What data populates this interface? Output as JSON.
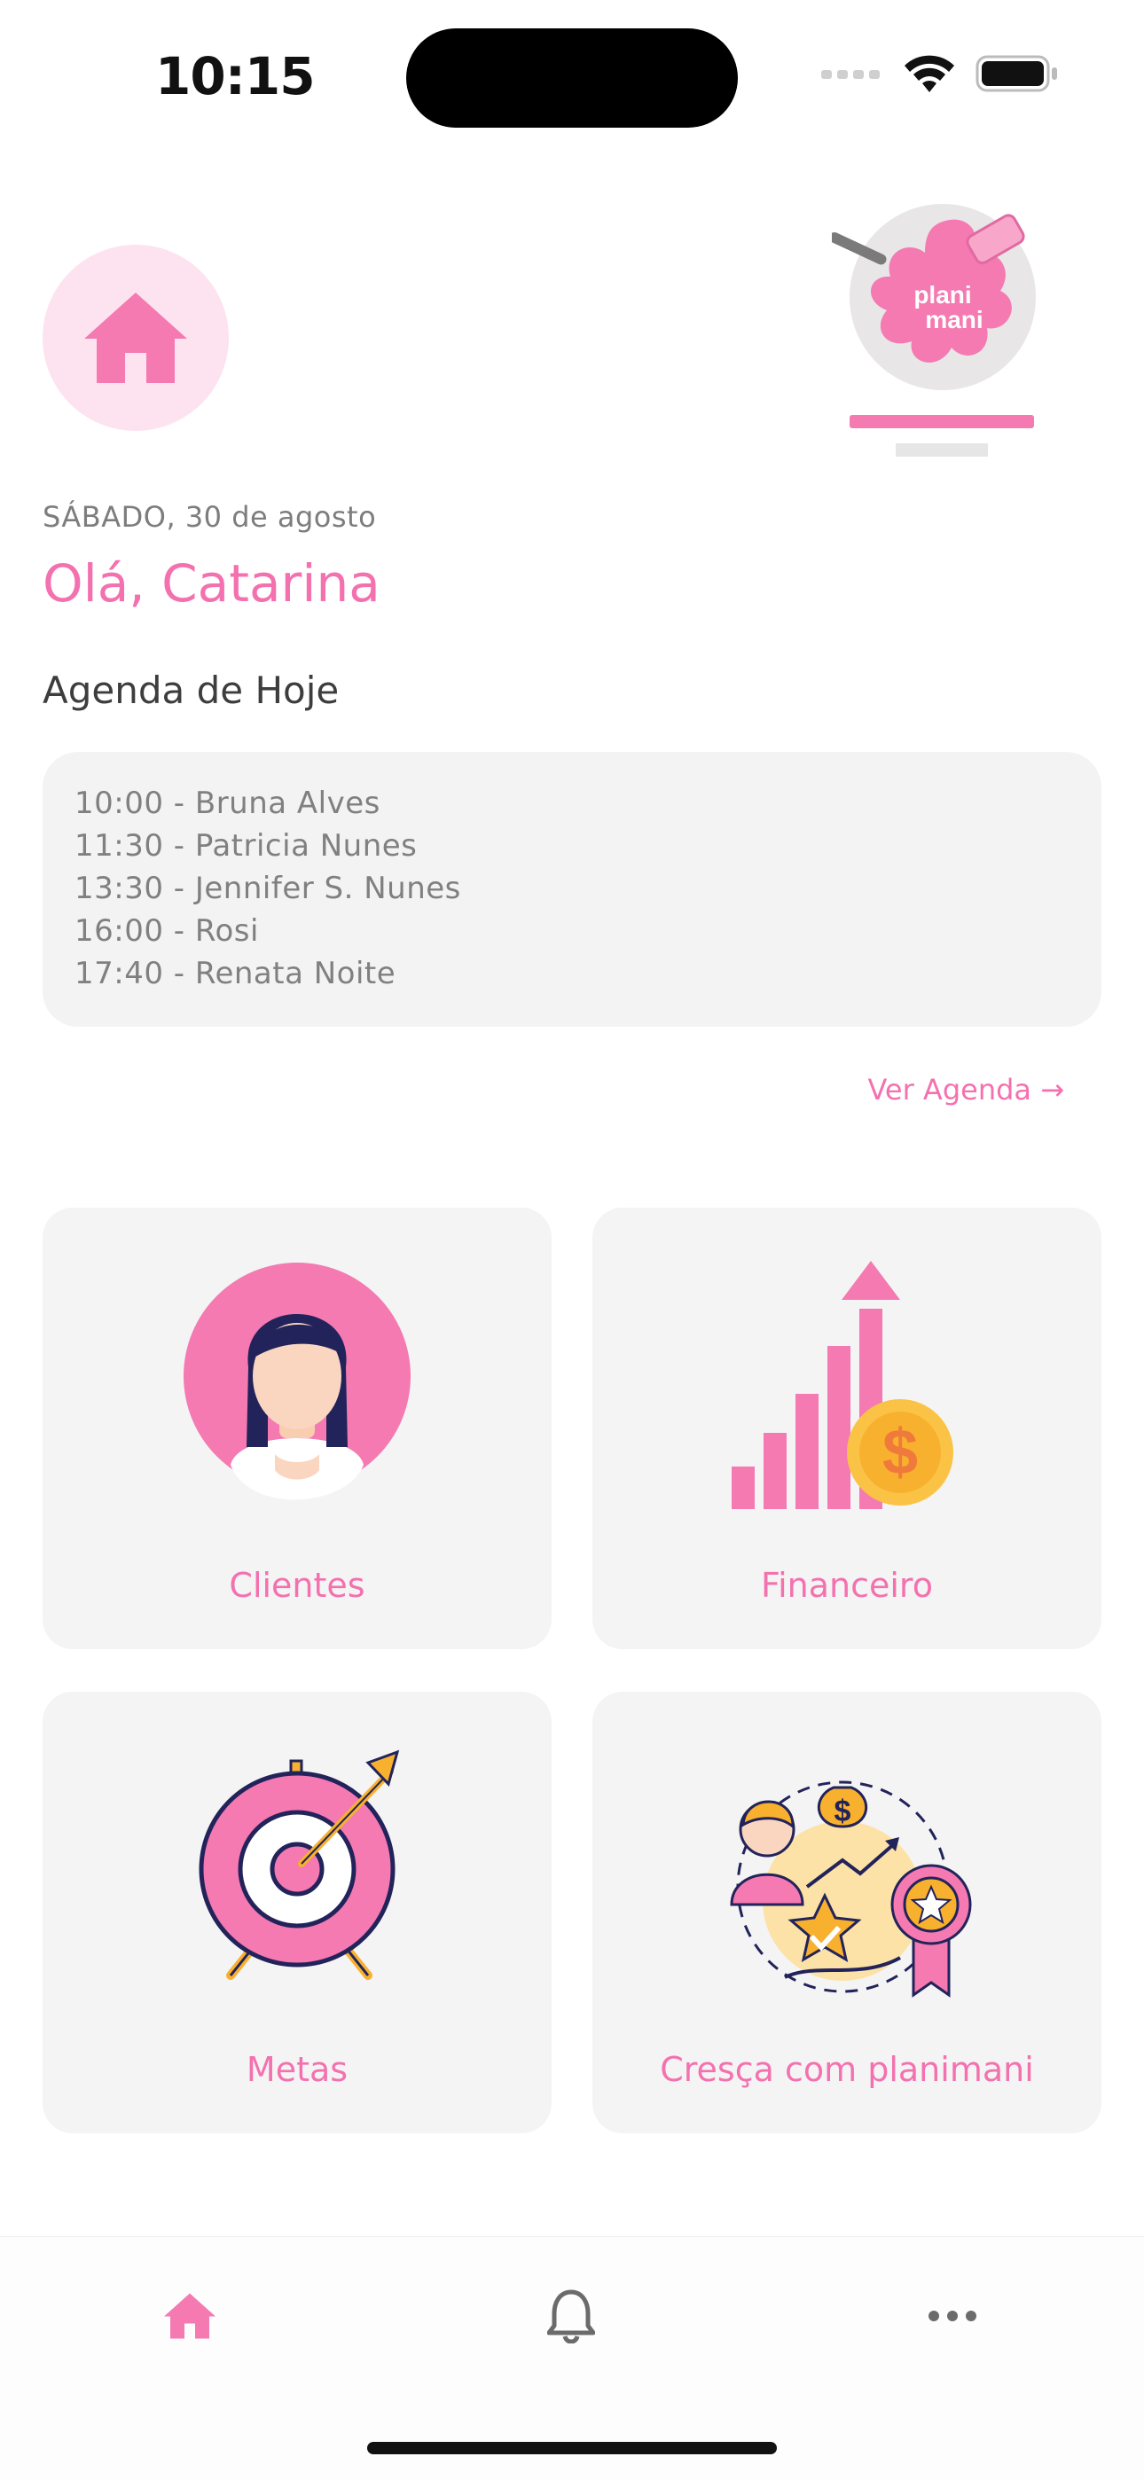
{
  "status_bar": {
    "time": "10:15"
  },
  "header": {
    "home_icon": "home-icon",
    "logo_text_line1": "plani",
    "logo_text_line2": "mani"
  },
  "greeting": {
    "date": "SÁBADO, 30 de agosto",
    "hello": "Olá, Catarina"
  },
  "agenda": {
    "title": "Agenda de Hoje",
    "items": [
      "10:00 - Bruna Alves",
      "11:30 - Patricia Nunes",
      "13:30 - Jennifer S. Nunes",
      "16:00 - Rosi",
      "17:40 - Renata Noite"
    ],
    "link": "Ver Agenda →"
  },
  "tiles": [
    {
      "label": "Clientes",
      "icon": "client-avatar-icon"
    },
    {
      "label": "Financeiro",
      "icon": "growth-chart-icon"
    },
    {
      "label": "Metas",
      "icon": "target-icon"
    },
    {
      "label": "Cresça com planimani",
      "icon": "growth-illustration-icon"
    }
  ],
  "tabbar": {
    "items": [
      "home-icon",
      "bell-icon",
      "more-icon"
    ],
    "active": "home-icon"
  },
  "colors": {
    "accent": "#f471af",
    "accent_light": "#fde3ef",
    "card": "#f4f4f4",
    "text_gray": "#808080"
  }
}
